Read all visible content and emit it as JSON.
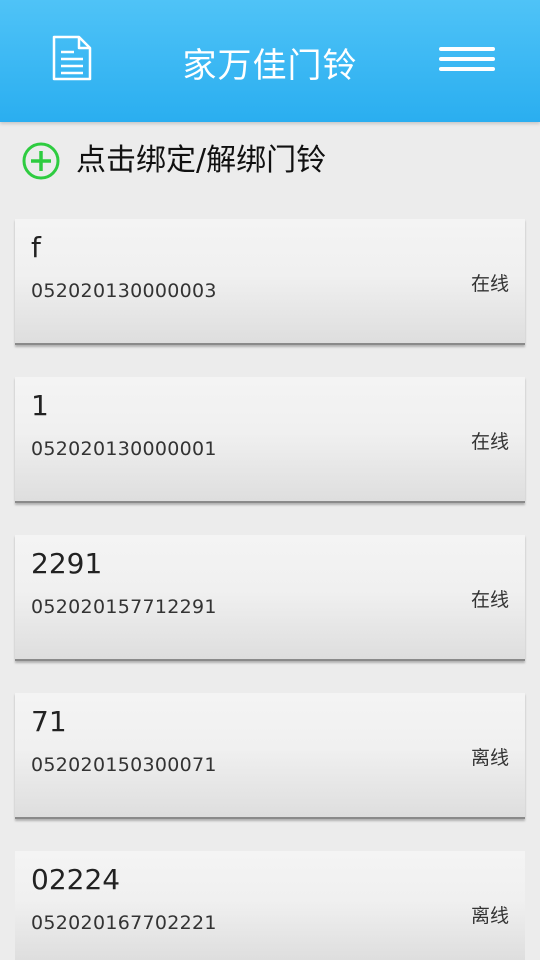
{
  "header": {
    "title": "家万佳门铃",
    "left_icon": "document-icon",
    "right_icon": "menu-icon"
  },
  "bind": {
    "label": "点击绑定/解绑门铃",
    "icon": "plus-circle-icon",
    "icon_color": "#2ecc40"
  },
  "colors": {
    "header": "#37b6f4",
    "background": "#ececec"
  },
  "devices": [
    {
      "name": "f",
      "id": "052020130000003",
      "status": "在线"
    },
    {
      "name": "1",
      "id": "052020130000001",
      "status": "在线"
    },
    {
      "name": "2291",
      "id": "052020157712291",
      "status": "在线"
    },
    {
      "name": "71",
      "id": "052020150300071",
      "status": "离线"
    },
    {
      "name": "02224",
      "id": "052020167702221",
      "status": "离线"
    }
  ]
}
